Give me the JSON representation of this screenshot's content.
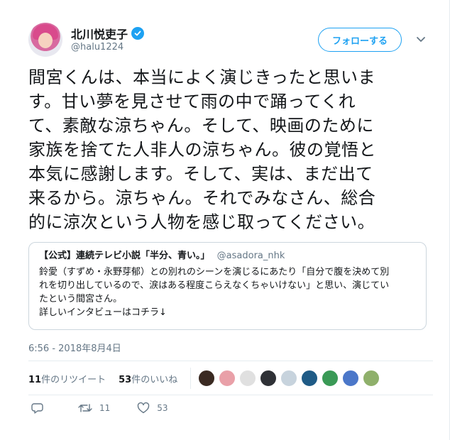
{
  "user": {
    "display_name": "北川悦吏子",
    "handle": "@halu1224",
    "verified": true,
    "follow_label": "フォローする"
  },
  "tweet": {
    "text": "間宮くんは、本当によく演じきったと思います。甘い夢を見させて雨の中で踊ってくれて、素敵な涼ちゃん。そして、映画のために家族を捨てた人非人の涼ちゃん。彼の覚悟と本気に感謝します。そして、実は、まだ出て来るから。涼ちゃん。それでみなさん、総合的に涼次という人物を感じ取ってください。",
    "lines": [
      "間宮くんは、本当によく演じきったと思いま",
      "す。甘い夢を見させて雨の中で踊ってくれ",
      "て、素敵な涼ちゃん。そして、映画のために",
      "家族を捨てた人非人の涼ちゃん。彼の覚悟と",
      "本気に感謝します。そして、実は、まだ出て",
      "来るから。涼ちゃん。それでみなさん、総合",
      "的に涼次という人物を感じ取ってください。"
    ],
    "timestamp": "6:56 - 2018年8月4日"
  },
  "quote": {
    "name": "【公式】連続テレビ小説「半分、青い。」",
    "handle": "@asadora_nhk",
    "lines": [
      "鈴愛（すずめ・永野芽郁）との別れのシーンを演じるにあたり「自分で腹を決めて別",
      "れを切り出しているので、涙はある程度こらえなくちゃいけない」と思い、演じてい",
      "たという間宮さん。",
      "詳しいインタビューはコチラ↓"
    ]
  },
  "stats": {
    "retweets_count": "11",
    "retweets_label": "件のリツイート",
    "likes_count": "53",
    "likes_label": "件のいいね"
  },
  "actions": {
    "retweet_count": "11",
    "like_count": "53"
  },
  "colors": {
    "accent": "#1da1f2",
    "text": "#14171a",
    "muted": "#657786",
    "border": "#e6ecf0",
    "retweet_green": "#17bf63"
  },
  "icons": [
    "verified-badge-icon",
    "chevron-down-icon",
    "reply-icon",
    "retweet-icon",
    "like-icon"
  ],
  "likers": [
    {
      "name": "liker-1",
      "color": "#3a2a22"
    },
    {
      "name": "liker-2",
      "color": "#e9a0a8"
    },
    {
      "name": "liker-3",
      "color": "#e0e0e0"
    },
    {
      "name": "liker-4",
      "color": "#2f3136"
    },
    {
      "name": "liker-5",
      "color": "#c7d3dd"
    },
    {
      "name": "liker-6",
      "color": "#1f5b86"
    },
    {
      "name": "liker-7",
      "color": "#3a9a56"
    },
    {
      "name": "liker-8",
      "color": "#4b77c9"
    },
    {
      "name": "liker-9",
      "color": "#8fb06b"
    }
  ]
}
